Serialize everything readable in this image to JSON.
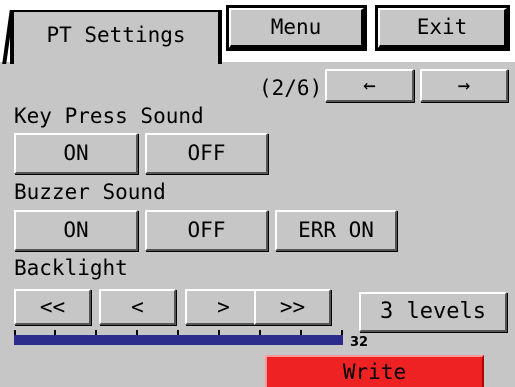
{
  "tabs": {
    "active_label": "PT Settings",
    "menu_label": "Menu",
    "exit_label": "Exit"
  },
  "pager": {
    "indicator": "(2/6)",
    "prev_icon": "left-arrow-icon",
    "prev_glyph": "←",
    "next_icon": "right-arrow-icon",
    "next_glyph": "→"
  },
  "key_press_sound": {
    "label": "Key Press Sound",
    "on_label": "ON",
    "off_label": "OFF"
  },
  "buzzer_sound": {
    "label": "Buzzer Sound",
    "on_label": "ON",
    "off_label": "OFF",
    "err_on_label": "ERR ON"
  },
  "backlight": {
    "label": "Backlight",
    "first_glyph": "<<",
    "dec_glyph": "<",
    "inc_glyph": ">",
    "last_glyph": ">>",
    "levels_label": "3 levels",
    "level_value": "32"
  },
  "write_label": "Write",
  "colors": {
    "panel": "#c6c6c6",
    "level_bar": "#2c2c8c",
    "write_button": "#ee2222"
  }
}
